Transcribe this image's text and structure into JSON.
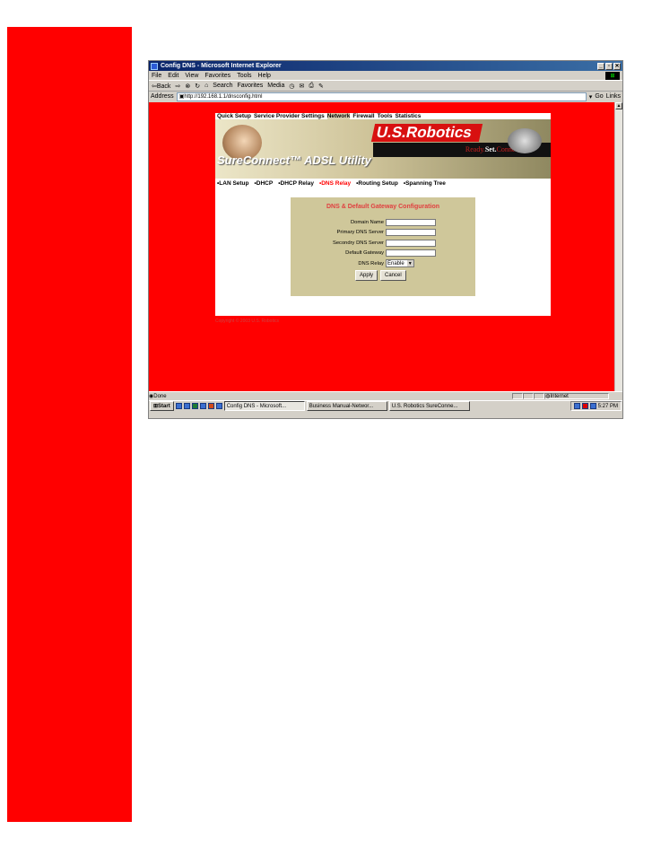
{
  "window": {
    "title": "Config DNS - Microsoft Internet Explorer",
    "min": "_",
    "max": "▫",
    "close": "✕"
  },
  "menu": [
    "File",
    "Edit",
    "View",
    "Favorites",
    "Tools",
    "Help"
  ],
  "toolbar": {
    "back": "⇦Back",
    "search": "Search",
    "favorites": "Favorites",
    "media": "Media"
  },
  "address": {
    "label": "Address",
    "url": "http://192.168.1.1/dnsconfig.html",
    "go": "Go",
    "links": "Links"
  },
  "site": {
    "topnav": [
      {
        "label": "Quick Setup",
        "active": false
      },
      {
        "label": "Service Provider Settings",
        "active": false
      },
      {
        "label": "Network",
        "active": true
      },
      {
        "label": "Firewall",
        "active": false
      },
      {
        "label": "Tools",
        "active": false
      },
      {
        "label": "Statistics",
        "active": false
      }
    ],
    "brand": "U.S.Robotics",
    "tagline_ready": "Ready.",
    "tagline_set": "Set.",
    "tagline_connect": "Connect.™",
    "product": "SureConnect™ ADSL Utility",
    "subnav": [
      {
        "label": "LAN Setup",
        "active": false
      },
      {
        "label": "DHCP",
        "active": false
      },
      {
        "label": "DHCP Relay",
        "active": false
      },
      {
        "label": "DNS Relay",
        "active": true
      },
      {
        "label": "Routing Setup",
        "active": false
      },
      {
        "label": "Spanning Tree",
        "active": false
      }
    ],
    "panel_title": "DNS & Default Gateway Configuration",
    "fields": {
      "domain": "Domain Name",
      "primary": "Primary DNS Server",
      "secondary": "Secondry DNS Server",
      "gateway": "Default Gateway",
      "relay": "DNS Relay"
    },
    "relay_value": "Enable",
    "apply": "Apply",
    "cancel": "Cancel",
    "copyright": "Copyright © 2003 U.S. Robotics"
  },
  "status": {
    "text": "Done",
    "zone": "Internet"
  },
  "taskbar": {
    "start": "Start",
    "tasks": [
      "Config DNS - Microsoft...",
      "Business Manual-Networ...",
      "U.S. Robotics SureConne..."
    ],
    "clock": "5:27 PM"
  },
  "colors": {
    "accent": "#ff0000",
    "panel": "#cfc79a",
    "title_bar": "#0a246a"
  }
}
